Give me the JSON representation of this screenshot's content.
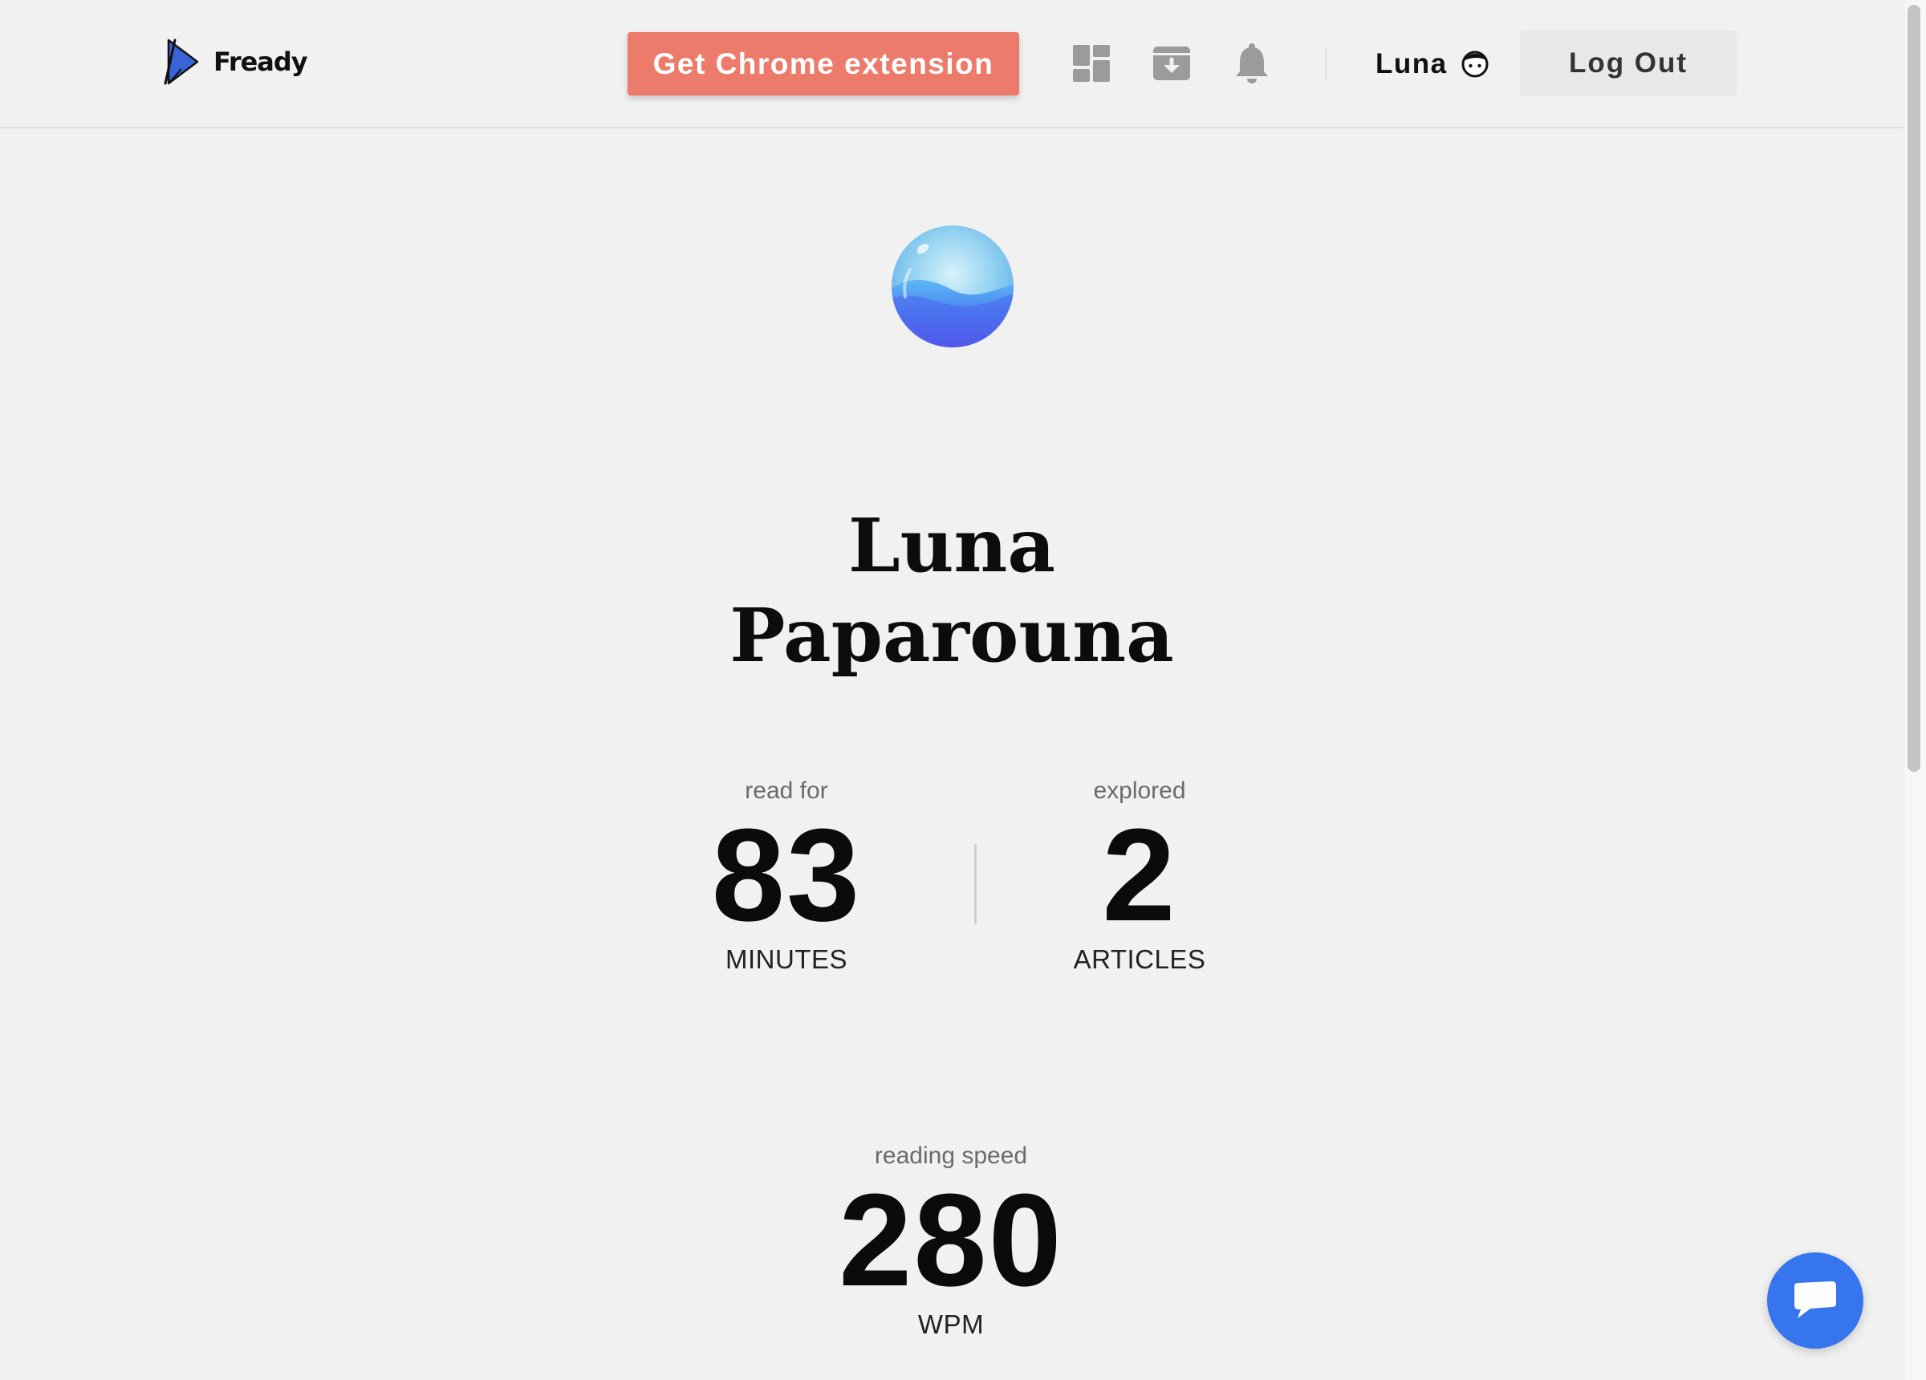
{
  "header": {
    "logo_text": "Fready",
    "chrome_button_label": "Get Chrome extension",
    "icons": [
      "dashboard-icon",
      "archive-icon",
      "bell-icon"
    ],
    "user_name": "Luna",
    "logout_label": "Log Out"
  },
  "profile": {
    "name_line1": "Luna",
    "name_line2": "Paparouna"
  },
  "stats": {
    "minutes": {
      "label": "read for",
      "value": "83",
      "unit": "MINUTES"
    },
    "articles": {
      "label": "explored",
      "value": "2",
      "unit": "ARTICLES"
    },
    "speed": {
      "label": "reading speed",
      "value": "280",
      "unit": "WPM"
    }
  },
  "colors": {
    "background": "#f1f1f1",
    "accent_button": "#ec7b6b",
    "chat_button": "#3675ee",
    "logo_blue": "#3a63d8"
  }
}
